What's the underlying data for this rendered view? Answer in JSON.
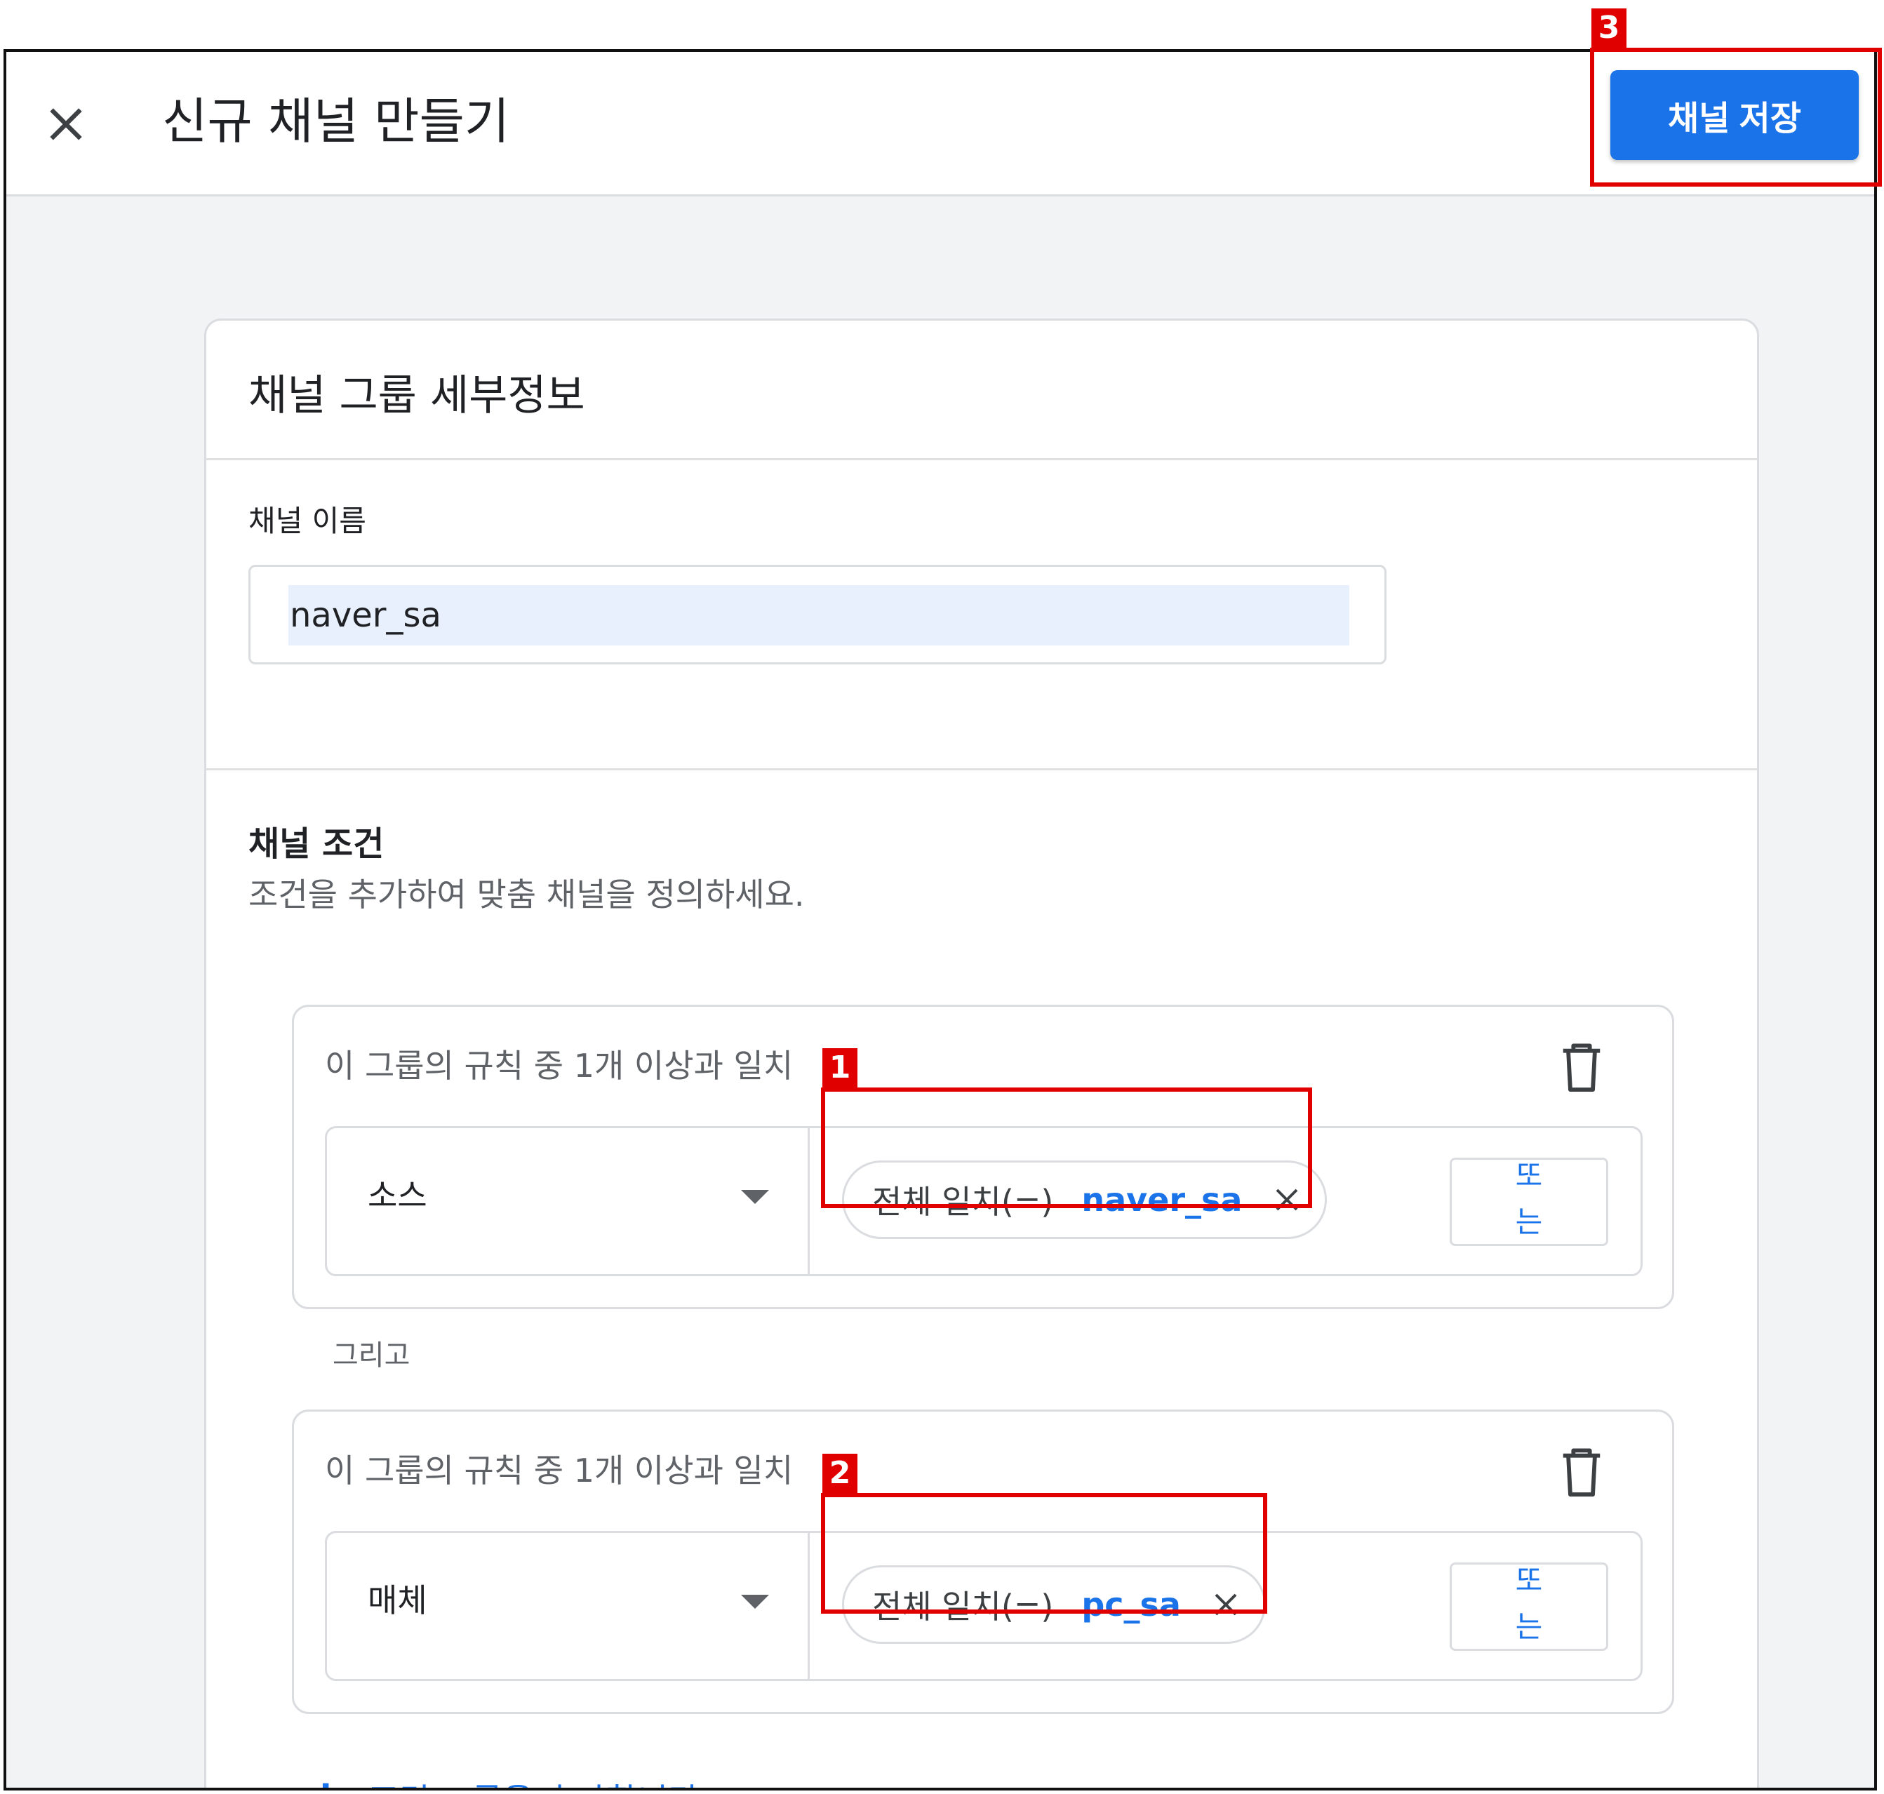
{
  "header": {
    "title": "신규 채널 만들기",
    "save_label": "채널 저장"
  },
  "card": {
    "title": "채널 그룹 세부정보",
    "name_label": "채널 이름",
    "name_value": "naver_sa",
    "conditions_title": "채널 조건",
    "conditions_desc": "조건을 추가하여 맞춤 채널을 정의하세요."
  },
  "groups": [
    {
      "title": "이 그룹의 규칙 중 1개 이상과 일치",
      "dimension": "소스",
      "operator": "전체 일치(=)",
      "value": "naver_sa",
      "or_label": "또는"
    },
    {
      "title": "이 그룹의 규칙 중 1개 이상과 일치",
      "dimension": "매체",
      "operator": "전체 일치(=)",
      "value": "pc_sa",
      "or_label": "또는"
    }
  ],
  "and_label": "그리고",
  "add_group_label": "조건 그룹을 추가합니다.",
  "annotations": [
    "1",
    "2",
    "3"
  ],
  "colors": {
    "accent": "#1a73e8",
    "highlight": "#e00000",
    "background": "#f1f3f4"
  }
}
